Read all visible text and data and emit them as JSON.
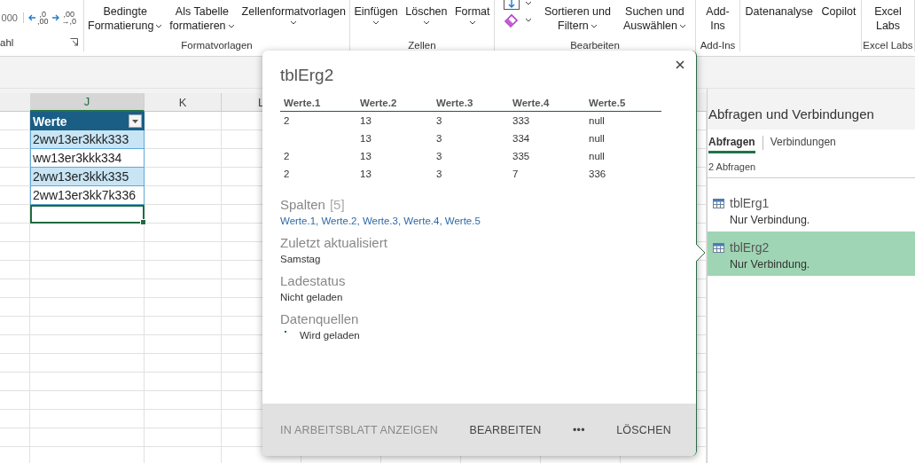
{
  "ribbon": {
    "groups": [
      {
        "label": "ahl",
        "launcher": true,
        "items": [
          {
            "kind": "text",
            "label": "000"
          },
          {
            "kind": "decrease-decimal",
            "digits": [
              ",0",
              ",00"
            ]
          },
          {
            "kind": "increase-decimal",
            "digits": [
              ",00",
              "→,0"
            ]
          }
        ]
      },
      {
        "label": "Formatvorlagen",
        "items": [
          {
            "kind": "button",
            "lines": [
              "Bedingte",
              "Formatierung"
            ],
            "dropdown": true
          },
          {
            "kind": "button",
            "lines": [
              "Als Tabelle",
              "formatieren"
            ],
            "dropdown": true
          },
          {
            "kind": "button",
            "lines": [
              "Zellenformatvorlagen"
            ],
            "dropdown": true
          }
        ]
      },
      {
        "label": "Zellen",
        "items": [
          {
            "kind": "button",
            "lines": [
              "Einfügen"
            ],
            "dropdown": true
          },
          {
            "kind": "button",
            "lines": [
              "Löschen"
            ],
            "dropdown": true
          },
          {
            "kind": "button",
            "lines": [
              "Format"
            ],
            "dropdown": true
          }
        ]
      },
      {
        "label": "Bearbeiten",
        "items": [
          {
            "kind": "tools"
          },
          {
            "kind": "button",
            "lines": [
              "Sortieren und",
              "Filtern"
            ],
            "dropdown": true
          },
          {
            "kind": "button",
            "lines": [
              "Suchen und",
              "Auswählen"
            ],
            "dropdown": true
          }
        ]
      },
      {
        "label": "Add-Ins",
        "items": [
          {
            "kind": "button",
            "lines": [
              "Add-",
              "Ins"
            ],
            "dropdown": false
          }
        ]
      },
      {
        "items": [
          {
            "kind": "button",
            "lines": [
              "Datenanalyse"
            ],
            "dropdown": false
          },
          {
            "kind": "button",
            "lines": [
              "Copilot"
            ],
            "dropdown": false
          }
        ]
      },
      {
        "label": "Excel Labs",
        "items": [
          {
            "kind": "button",
            "lines": [
              "Excel",
              "Labs"
            ],
            "dropdown": false
          }
        ]
      }
    ]
  },
  "sheet": {
    "columns": [
      {
        "label": "J",
        "selected": true
      },
      {
        "label": "K",
        "selected": false
      },
      {
        "label": "L",
        "selected": false
      }
    ],
    "table": {
      "header": "Werte",
      "rows": [
        "2ww13er3kkk333",
        "ww13er3kkk334",
        "2ww13er3kkk335",
        "2ww13er3kk7k336"
      ]
    },
    "active_cell": {
      "selected": true
    }
  },
  "popup": {
    "title": "tblErg2",
    "columns": [
      "Werte.1",
      "Werte.2",
      "Werte.3",
      "Werte.4",
      "Werte.5"
    ],
    "rows": [
      [
        "2",
        "13",
        "3",
        "333",
        "null"
      ],
      [
        null,
        "13",
        "3",
        "334",
        "null"
      ],
      [
        "2",
        "13",
        "3",
        "335",
        "null"
      ],
      [
        "2",
        "13",
        "3",
        "7",
        "336"
      ]
    ],
    "sections": [
      {
        "kind": "link",
        "heading": "Spalten",
        "count": "[5]",
        "text": "Werte.1, Werte.2, Werte.3, Werte.4, Werte.5"
      },
      {
        "kind": "text",
        "heading": "Zuletzt aktualisiert",
        "text": "Samstag"
      },
      {
        "kind": "text",
        "heading": "Ladestatus",
        "text": "Nicht geladen"
      },
      {
        "kind": "list",
        "heading": "Datenquellen",
        "items": [
          "Wird geladen"
        ]
      }
    ],
    "buttons": [
      {
        "label": "IN ARBEITSBLATT ANZEIGEN",
        "disabled": true
      },
      {
        "label": "BEARBEITEN",
        "disabled": false
      },
      {
        "label": "•••",
        "disabled": false
      },
      {
        "label": "LÖSCHEN",
        "disabled": false
      }
    ]
  },
  "pane": {
    "title": "Abfragen und Verbindungen",
    "tabs": [
      {
        "label": "Abfragen",
        "selected": true
      },
      {
        "label": "Verbindungen",
        "selected": false
      }
    ],
    "count": "2 Abfragen",
    "queries": [
      {
        "name": "tblErg1",
        "status": "Nur Verbindung.",
        "selected": false
      },
      {
        "name": "tblErg2",
        "status": "Nur Verbindung.",
        "selected": true
      }
    ]
  }
}
